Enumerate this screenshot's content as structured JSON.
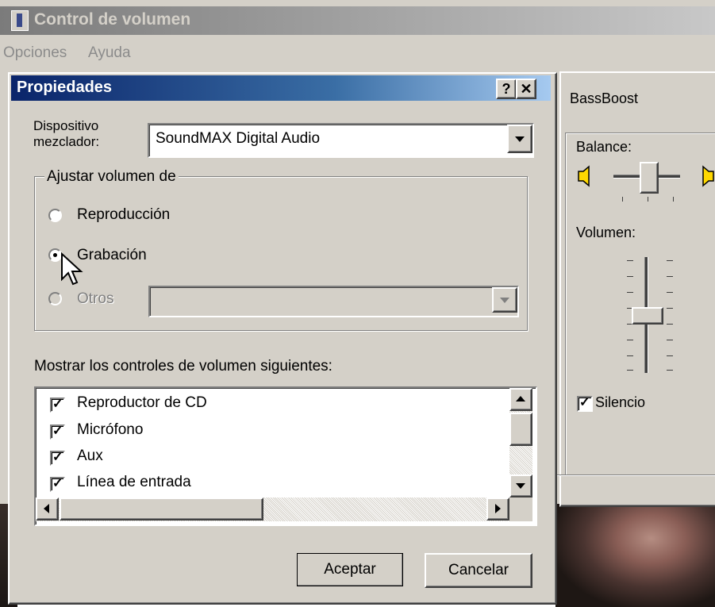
{
  "mixer": {
    "title": "Control de volumen",
    "menu": [
      "Opciones",
      "Ayuda"
    ],
    "panel": {
      "name": "BassBoost",
      "balance_label": "Balance:",
      "volume_label": "Volumen:",
      "mute_label": "Silencio",
      "mute_checked": true
    }
  },
  "dialog": {
    "title": "Propiedades",
    "help_glyph": "?",
    "close_glyph": "✕",
    "mixer_device_label": "Dispositivo mezclador:",
    "mixer_device_value": "SoundMAX Digital Audio",
    "adjust_group_label": "Ajustar volumen de",
    "options": [
      {
        "label": "Reproducción",
        "selected": false,
        "enabled": true
      },
      {
        "label": "Grabación",
        "selected": true,
        "enabled": true
      },
      {
        "label": "Otros",
        "selected": false,
        "enabled": false
      }
    ],
    "show_controls_label": "Mostrar los controles de volumen siguientes:",
    "controls": [
      {
        "label": "Reproductor de CD",
        "checked": true
      },
      {
        "label": "Micrófono",
        "checked": true
      },
      {
        "label": "Aux",
        "checked": true
      },
      {
        "label": "Línea de entrada",
        "checked": true
      }
    ],
    "ok_label": "Aceptar",
    "cancel_label": "Cancelar"
  },
  "colors": {
    "face": "#d4d0c8",
    "dialog_title_start": "#0a246a",
    "dialog_title_end": "#a6caf0",
    "inactive_title": "#7b7b7b"
  }
}
